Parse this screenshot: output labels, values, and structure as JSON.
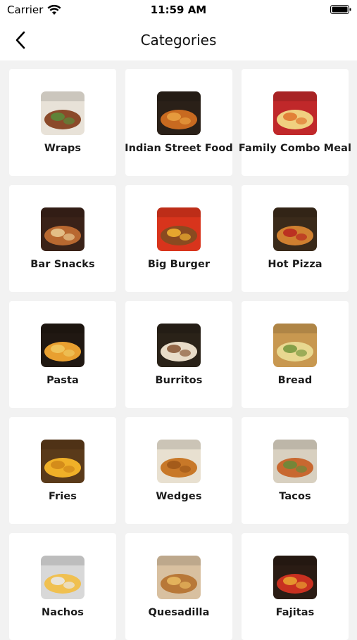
{
  "status_bar": {
    "carrier": "Carrier",
    "time": "11:59 AM"
  },
  "nav": {
    "title": "Categories",
    "back_icon": "chevron-left-icon"
  },
  "categories": [
    {
      "label": "Wraps",
      "colors": [
        "#e8e2d8",
        "#8b4a2a",
        "#5a8a3a"
      ]
    },
    {
      "label": "Indian Street Food",
      "colors": [
        "#2a2018",
        "#c86a20",
        "#e8a040"
      ]
    },
    {
      "label": "Family Combo Meal",
      "colors": [
        "#c0282a",
        "#f0d080",
        "#e07830"
      ]
    },
    {
      "label": "Bar Snacks",
      "colors": [
        "#3a2218",
        "#b86830",
        "#e8c890"
      ]
    },
    {
      "label": "Big Burger",
      "colors": [
        "#d8341c",
        "#8a4a20",
        "#f0b030"
      ]
    },
    {
      "label": "Hot Pizza",
      "colors": [
        "#3a2a1a",
        "#d08030",
        "#b82820"
      ]
    },
    {
      "label": "Pasta",
      "colors": [
        "#201812",
        "#e8a030",
        "#f0c860"
      ]
    },
    {
      "label": "Burritos",
      "colors": [
        "#2a2218",
        "#e8dcc8",
        "#8a5a38"
      ]
    },
    {
      "label": "Bread",
      "colors": [
        "#c89850",
        "#e8d890",
        "#7a9a40"
      ]
    },
    {
      "label": "Fries",
      "colors": [
        "#5a3a1a",
        "#f0b028",
        "#d08818"
      ]
    },
    {
      "label": "Wedges",
      "colors": [
        "#e8e0d0",
        "#c87828",
        "#a05818"
      ]
    },
    {
      "label": "Tacos",
      "colors": [
        "#d8d0c0",
        "#c86830",
        "#6a8a3a"
      ]
    },
    {
      "label": "Nachos",
      "colors": [
        "#d8d8d8",
        "#f0c050",
        "#e8e8e8"
      ]
    },
    {
      "label": "Quesadilla",
      "colors": [
        "#d8c0a0",
        "#b87838",
        "#e8b860"
      ]
    },
    {
      "label": "Fajitas",
      "colors": [
        "#2a1c14",
        "#c83020",
        "#e8a030"
      ]
    }
  ]
}
